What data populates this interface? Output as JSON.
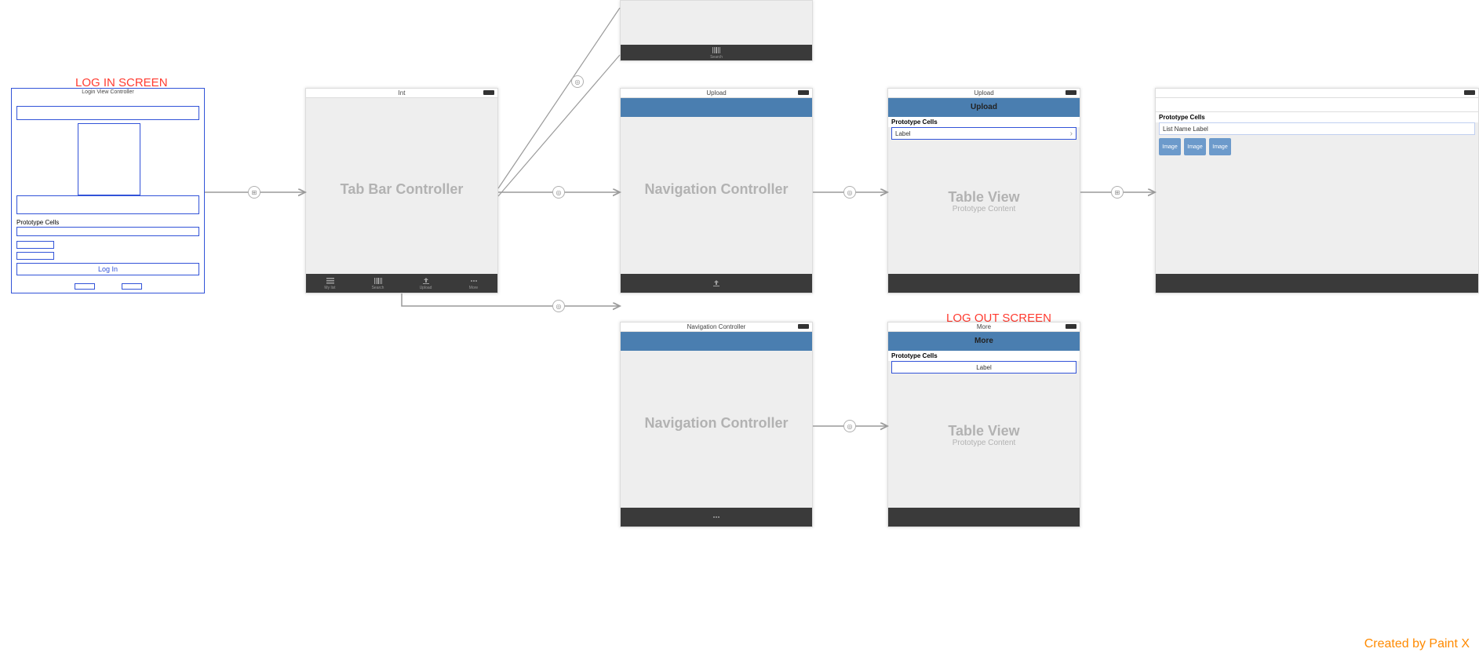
{
  "annotations": {
    "login": "LOG IN SCREEN",
    "logout": "LOG OUT SCREEN"
  },
  "watermark": "Created by Paint X",
  "login_scene": {
    "title": "Login View Controller",
    "prototype_header": "Prototype Cells",
    "login_button": "Log In"
  },
  "tabbar_scene": {
    "title": "Int",
    "ghost": "Tab Bar Controller",
    "tabs": [
      "My list",
      "Search",
      "Upload",
      "More"
    ]
  },
  "nav_upload": {
    "title": "Upload",
    "ghost": "Navigation Controller"
  },
  "table_upload": {
    "title": "Upload",
    "nav_title": "Upload",
    "prototype_header": "Prototype Cells",
    "cell_label": "Label",
    "ghost_main": "Table View",
    "ghost_sub": "Prototype Content"
  },
  "list_scene": {
    "prototype_header": "Prototype Cells",
    "cell_label": "List Name Label",
    "thumbs": [
      "Image",
      "Image",
      "Image"
    ]
  },
  "nav_more": {
    "title": "Navigation Controller",
    "ghost": "Navigation Controller"
  },
  "table_more": {
    "title": "More",
    "nav_title": "More",
    "prototype_header": "Prototype Cells",
    "cell_label": "Label",
    "ghost_main": "Table View",
    "ghost_sub": "Prototype Content"
  },
  "top_clipped": {
    "tab_label": "Search"
  }
}
